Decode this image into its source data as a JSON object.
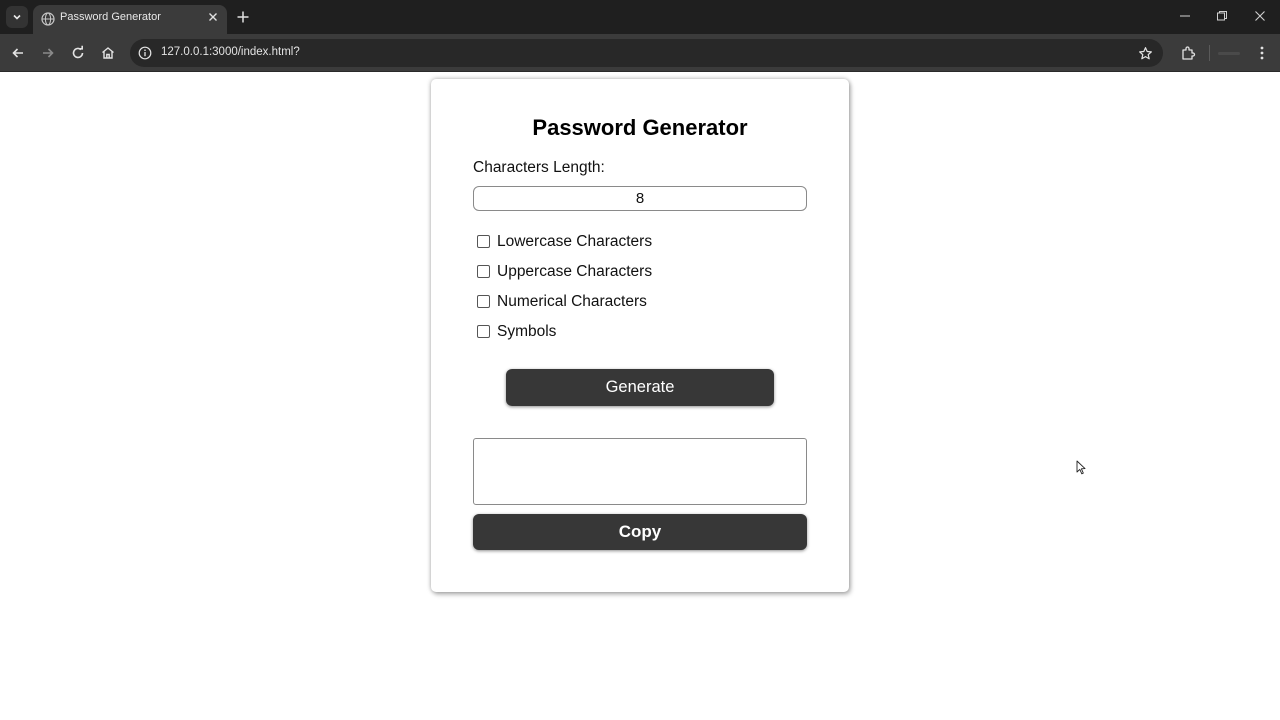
{
  "browser": {
    "tab_title": "Password Generator",
    "url": "127.0.0.1:3000/index.html?",
    "icons": [
      "tab-search-icon",
      "globe-icon",
      "close-icon",
      "new-tab-icon",
      "minimize-icon",
      "restore-icon",
      "window-close-icon",
      "back-icon",
      "forward-icon",
      "reload-icon",
      "home-icon",
      "site-info-icon",
      "star-icon",
      "extensions-icon",
      "menu-icon"
    ]
  },
  "app": {
    "title": "Password Generator",
    "length_label": "Characters Length:",
    "length_value": "8",
    "options": [
      {
        "label": "Lowercase Characters",
        "checked": false
      },
      {
        "label": "Uppercase Characters",
        "checked": false
      },
      {
        "label": "Numerical Characters",
        "checked": false
      },
      {
        "label": "Symbols",
        "checked": false
      }
    ],
    "generate_label": "Generate",
    "output_value": "",
    "copy_label": "Copy"
  },
  "colors": {
    "button_bg": "#373737",
    "chrome_dark": "#1f1f1f",
    "chrome_toolbar": "#3b3b3b"
  }
}
